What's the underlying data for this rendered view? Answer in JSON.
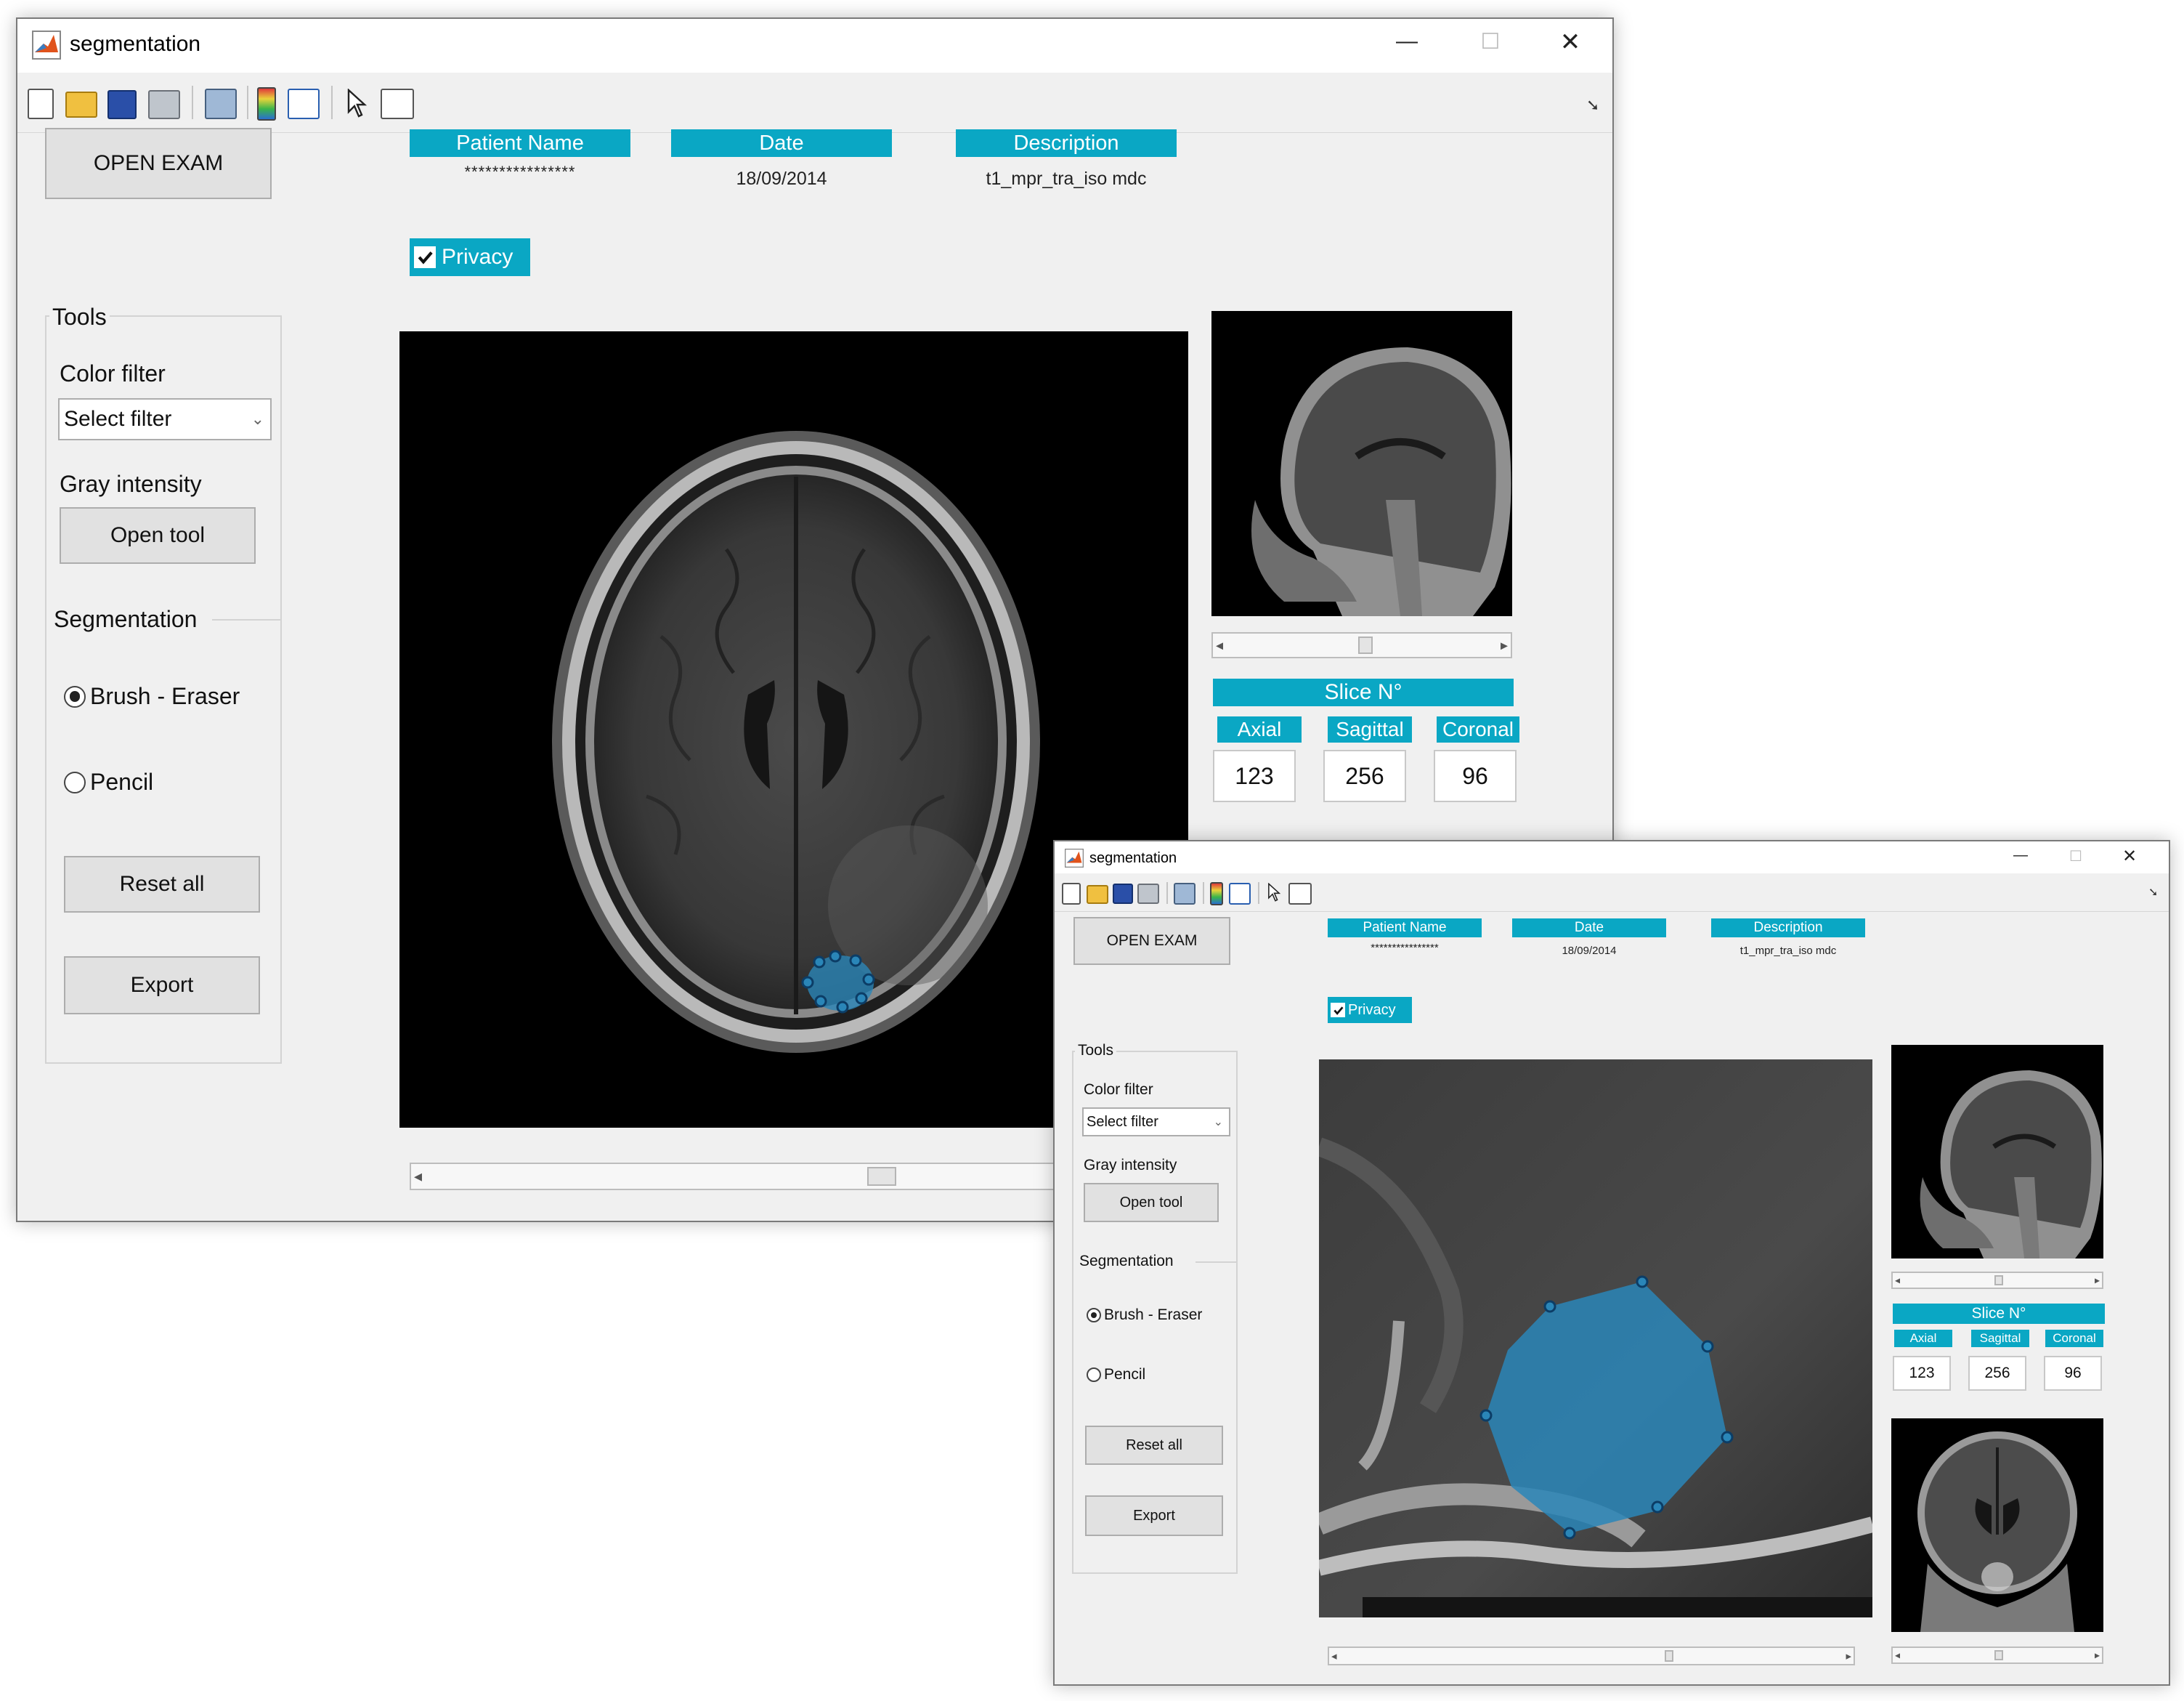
{
  "window": {
    "title": "segmentation",
    "controls": {
      "minimize": "—",
      "maximize": "☐",
      "close": "✕"
    }
  },
  "toolbar": {
    "icons": [
      "new-file-icon",
      "open-folder-icon",
      "save-icon",
      "print-icon",
      "print-preview-icon",
      "colorbar-icon",
      "legend-icon",
      "pointer-icon",
      "property-inspector-icon"
    ],
    "overflow_glyph": "➘"
  },
  "open_exam_label": "OPEN EXAM",
  "info": {
    "patient_name": {
      "label": "Patient Name",
      "value": "****************"
    },
    "date": {
      "label": "Date",
      "value": "18/09/2014"
    },
    "description": {
      "label": "Description",
      "value": "t1_mpr_tra_iso mdc"
    }
  },
  "privacy": {
    "label": "Privacy",
    "checked": true
  },
  "tools": {
    "title": "Tools",
    "color_filter_label": "Color filter",
    "color_filter_value": "Select filter",
    "gray_intensity_label": "Gray intensity",
    "open_tool_label": "Open tool",
    "segmentation_title": "Segmentation",
    "brush_eraser_label": "Brush - Eraser",
    "brush_eraser_selected": true,
    "pencil_label": "Pencil",
    "pencil_selected": false,
    "reset_label": "Reset all",
    "export_label": "Export"
  },
  "slice": {
    "title": "Slice N°",
    "axial": {
      "label": "Axial",
      "value": "123"
    },
    "sagittal": {
      "label": "Sagittal",
      "value": "256"
    },
    "coronal": {
      "label": "Coronal",
      "value": "96"
    }
  },
  "scroll_arrows": {
    "left": "◂",
    "right": "▸"
  },
  "colors": {
    "accent": "#0aa7c4",
    "segmentation": "#2a86b8",
    "window_bg": "#f0f0f0"
  }
}
